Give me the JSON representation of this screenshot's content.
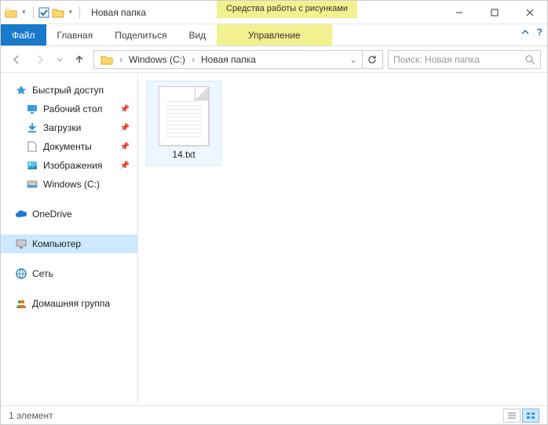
{
  "window": {
    "title": "Новая папка"
  },
  "ribbon": {
    "context_header": "Средства работы с рисунками",
    "tabs": {
      "file": "Файл",
      "home": "Главная",
      "share": "Поделиться",
      "view": "Вид",
      "manage": "Управление"
    }
  },
  "address": {
    "seg1": "Windows (C:)",
    "seg2": "Новая папка"
  },
  "search": {
    "placeholder": "Поиск: Новая папка"
  },
  "sidebar": {
    "quick_access": "Быстрый доступ",
    "desktop": "Рабочий стол",
    "downloads": "Загрузки",
    "documents": "Документы",
    "pictures": "Изображения",
    "drive_c": "Windows (C:)",
    "onedrive": "OneDrive",
    "computer": "Компьютер",
    "network": "Сеть",
    "homegroup": "Домашняя группа"
  },
  "files": {
    "item1": "14.txt"
  },
  "status": {
    "count": "1 элемент"
  }
}
